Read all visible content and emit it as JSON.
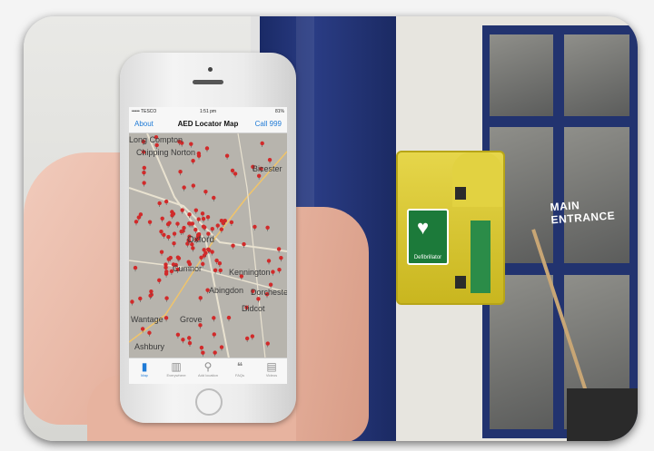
{
  "status_bar": {
    "carrier": "••••• TESCO",
    "time": "1:51 pm",
    "battery": "81%"
  },
  "nav_bar": {
    "left_button": "About",
    "title": "AED Locator Map",
    "right_button": "Call 999"
  },
  "map": {
    "places": [
      "Long Compton",
      "Chipping Norton",
      "Bicester",
      "Oxford",
      "Cumnor",
      "Kennington",
      "Abingdon",
      "Dorchester",
      "Didcot",
      "Wantage",
      "Grove",
      "Ashbury"
    ],
    "marker_color": "#d12a2a"
  },
  "tab_bar": {
    "tabs": [
      {
        "label": "Map",
        "icon": "map-icon",
        "active": true
      },
      {
        "label": "Everywhere",
        "icon": "book-icon",
        "active": false
      },
      {
        "label": "Add location",
        "icon": "pin-icon",
        "active": false
      },
      {
        "label": "FAQs",
        "icon": "faq-icon",
        "active": false
      },
      {
        "label": "Videos",
        "icon": "film-icon",
        "active": false
      }
    ]
  },
  "scene": {
    "cabinet_sign": "Defibrillator",
    "door_sign": "MAIN ENTRANCE",
    "accent_green": "#1c7a3a",
    "accent_yellow": "#e2d241",
    "accent_blue": "#1e7ad6"
  }
}
